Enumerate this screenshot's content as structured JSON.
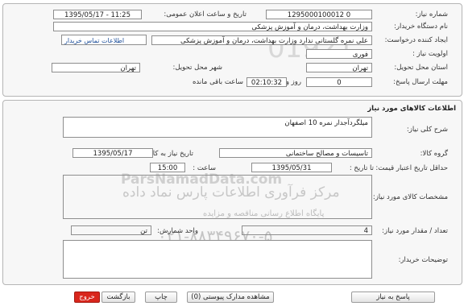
{
  "header": {
    "need_number_label": "شماره نیاز:",
    "need_number": "1295000100012 0",
    "announce_label": "تاریخ و ساعت اعلان عمومی:",
    "announce_value": "1395/05/17 - 11:25",
    "buyer_org_label": "نام دستگاه خریدار:",
    "buyer_org": "وزارت بهداشت، درمان و آموزش پزشکی",
    "creator_label": "ایجاد کننده درخواست:",
    "creator": "علی نمره گلستانی ندارد وزارت بهداشت، درمان و آموزش پزشکی",
    "buyer_contact_link": "اطلاعات تماس خریدار",
    "priority_label": "اولویت نیاز :",
    "priority": "فوری",
    "province_label": "استان محل تحویل:",
    "province": "تهران",
    "city_label": "شهر محل تحویل:",
    "city": "تهران",
    "deadline_label": "مهلت ارسال پاسخ:",
    "deadline_days": "0",
    "days_word": "روز و",
    "deadline_time": "02:10:32",
    "remaining_word": "ساعت باقی مانده"
  },
  "goods": {
    "section_title": "اطلاعات کالاهای مورد نیاز",
    "summary_label": "شرح کلی نیاز:",
    "summary": "میلگردآجدار نمره 10 اصفهان",
    "group_label": "گروه کالا:",
    "group": "تاسیسات و مصالح ساختمانی",
    "need_date_label": "تاریخ نیاز به کالا:",
    "need_date": "1395/05/17",
    "min_price_label": "حداقل تاریخ اعتبار قیمت:",
    "to_date_label": "تا تاریخ :",
    "to_date": "1395/05/31",
    "time_label": "ساعت :",
    "time": "15:00",
    "specs_label": "مشخصات کالای مورد نیاز:",
    "count_label": "تعداد / مقدار مورد نیاز:",
    "count": "4",
    "unit_label": "واحد شمارش:",
    "unit": "تن",
    "buyer_notes_label": "توضیحات خریدار:"
  },
  "watermark": {
    "line1": "مرکز فرآوری اطلاعات پارس نماد داده",
    "line2": "پایگاه اطلاع رسانی مناقصه و مزایده",
    "phone": "۰۲۱-۸۸۳۴۹۶۷۰-۵",
    "latin": "ParsNamadData.com",
    "digits": "01921"
  },
  "footer": {
    "reply_button": "پاسخ به نیاز",
    "attachments_button": "مشاهده مدارک پیوستی (0)",
    "print_button": "چاپ",
    "back_button": "بازگشت",
    "exit_button": "خروج"
  }
}
